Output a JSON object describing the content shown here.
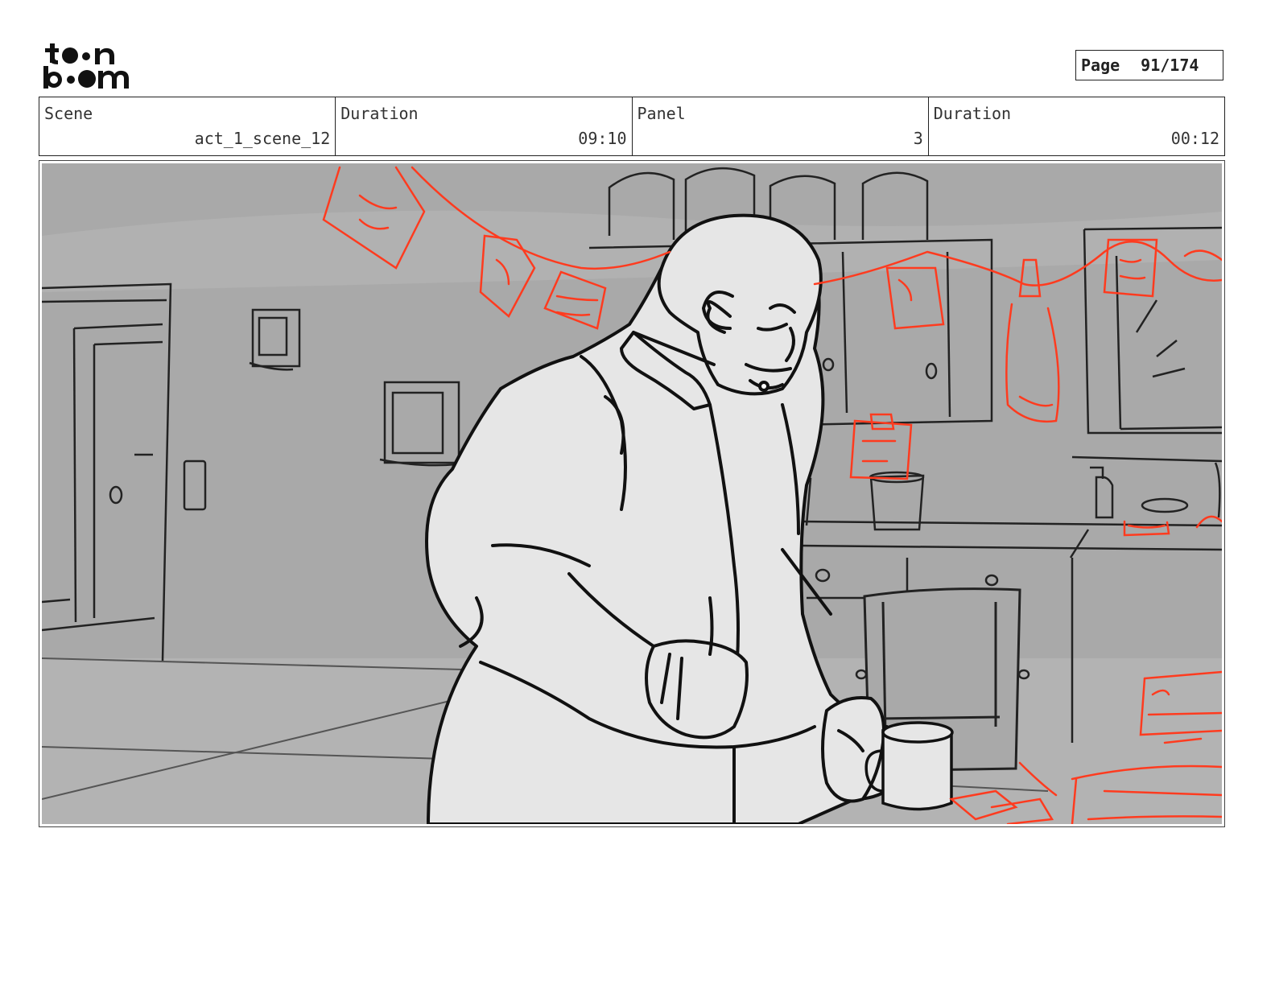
{
  "header": {
    "logo_text": "toon boom",
    "page_label": "Page",
    "page_value": "91/174"
  },
  "info": {
    "scene_label": "Scene",
    "scene_value": "act_1_scene_12",
    "scene_duration_label": "Duration",
    "scene_duration_value": "09:10",
    "panel_label": "Panel",
    "panel_value": "3",
    "panel_duration_label": "Duration",
    "panel_duration_value": "00:12"
  },
  "colors": {
    "sketch_red": "#ff3b1f",
    "background_gray": "#a9a9a9",
    "character_fill": "#e6e6e6"
  }
}
